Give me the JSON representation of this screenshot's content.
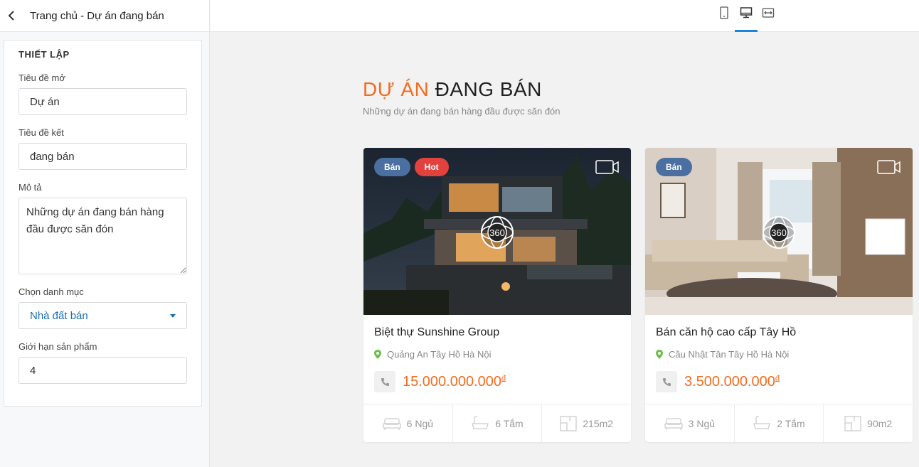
{
  "header": {
    "title": "Trang chủ - Dự án đang bán"
  },
  "settings": {
    "title": "THIẾT LẬP",
    "open_title_label": "Tiêu đề mở",
    "open_title_value": "Dự án",
    "close_title_label": "Tiêu đề kết",
    "close_title_value": "đang bán",
    "desc_label": "Mô tả",
    "desc_value": "Những dự án đang bán hàng đầu được săn đón",
    "category_label": "Chọn danh mục",
    "category_value": "Nhà đất bán",
    "limit_label": "Giới hạn sản phẩm",
    "limit_value": "4"
  },
  "devices": [
    "tablet-icon",
    "desktop-icon",
    "fullwidth-icon"
  ],
  "preview": {
    "heading_open": "DỰ ÁN",
    "heading_close": "ĐANG BÁN",
    "subheading": "Những dự án đang bán hàng đầu được săn đón",
    "cards": [
      {
        "badges": [
          "Bán",
          "Hot"
        ],
        "name": "Biệt thự Sunshine Group",
        "location": "Quảng An Tây Hồ Hà Nội",
        "price": "15.000.000.000",
        "currency": "đ",
        "beds": "6 Ngủ",
        "baths": "6 Tắm",
        "area": "215m2",
        "pano_label": "360"
      },
      {
        "badges": [
          "Bán"
        ],
        "name": "Bán căn hộ cao cấp Tây Hồ",
        "location": "Cầu Nhật Tân Tây Hồ Hà Nội",
        "price": "3.500.000.000",
        "currency": "đ",
        "beds": "3 Ngủ",
        "baths": "2 Tắm",
        "area": "90m2",
        "pano_label": "360"
      }
    ]
  },
  "colors": {
    "accent": "#f26c1f",
    "active_tab": "#1b86d8",
    "badge_ban": "#4a6fa0",
    "badge_hot": "#e2423d",
    "link": "#1a6fb0"
  }
}
